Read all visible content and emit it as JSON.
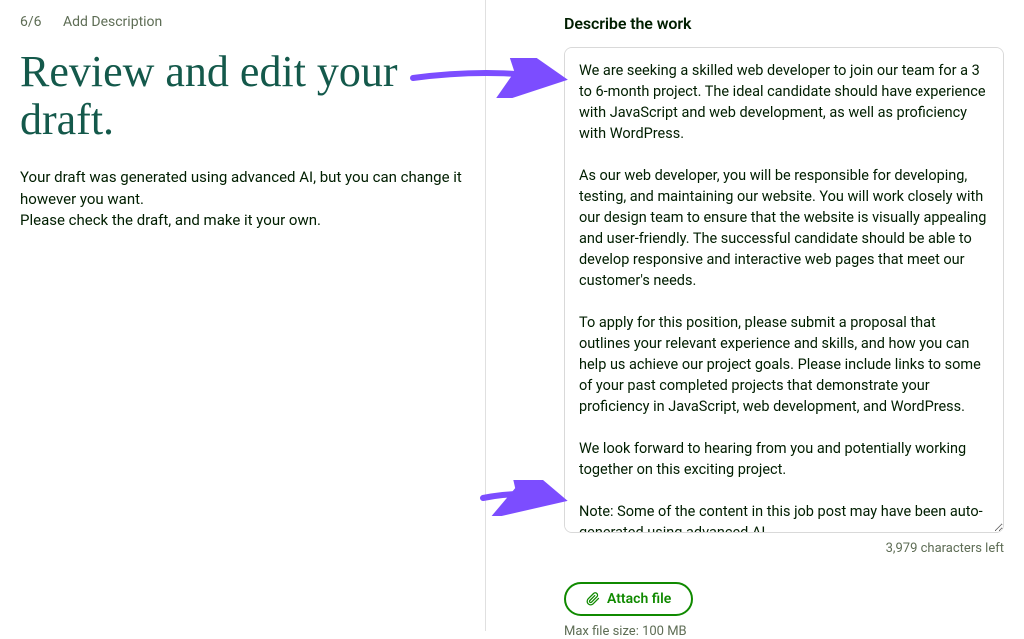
{
  "breadcrumb": {
    "step": "6/6",
    "label": "Add Description"
  },
  "page": {
    "title": "Review and edit your draft.",
    "subtitle_line1": "Your draft was generated using advanced AI, but you can change it however you want.",
    "subtitle_line2": "Please check the draft, and make it your own."
  },
  "section": {
    "heading": "Describe the work"
  },
  "description": {
    "value": "We are seeking a skilled web developer to join our team for a 3 to 6-month project. The ideal candidate should have experience with JavaScript and web development, as well as proficiency with WordPress.\n\nAs our web developer, you will be responsible for developing, testing, and maintaining our website. You will work closely with our design team to ensure that the website is visually appealing and user-friendly. The successful candidate should be able to develop responsive and interactive web pages that meet our customer's needs.\n\nTo apply for this position, please submit a proposal that outlines your relevant experience and skills, and how you can help us achieve our project goals. Please include links to some of your past completed projects that demonstrate your proficiency in JavaScript, web development, and WordPress.\n\nWe look forward to hearing from you and potentially working together on this exciting project.\n\nNote: Some of the content in this job post may have been auto-generated using advanced AI.",
    "char_counter": "3,979 characters left"
  },
  "attach": {
    "button_label": "Attach file",
    "file_size_note": "Max file size: 100 MB"
  },
  "colors": {
    "arrow": "#7c4dff"
  }
}
